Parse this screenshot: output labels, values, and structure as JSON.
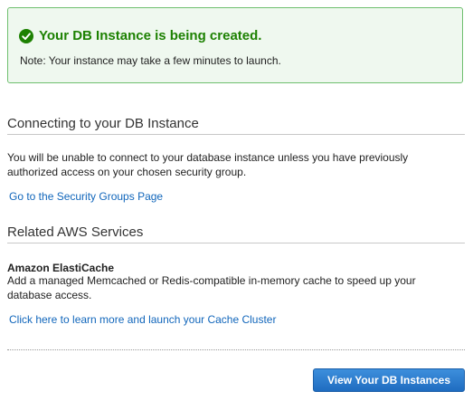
{
  "alert": {
    "title": "Your DB Instance is being created.",
    "note": "Note: Your instance may take a few minutes to launch.",
    "icon": "check-circle-icon",
    "color": "#1d8102"
  },
  "connecting": {
    "heading": "Connecting to your DB Instance",
    "text": "You will be unable to connect to your database instance unless you have previously authorized access on your chosen security group.",
    "link": "Go to the Security Groups Page"
  },
  "related": {
    "heading": "Related AWS Services",
    "service_name": "Amazon ElastiCache",
    "service_text": "Add a managed Memcached or Redis-compatible in-memory cache to speed up your database access.",
    "link": "Click here to learn more and launch your Cache Cluster"
  },
  "footer": {
    "button_label": "View Your DB Instances"
  },
  "colors": {
    "link": "#1166bb",
    "button": "#2a7bd0",
    "success_bg": "#eff8ef"
  }
}
